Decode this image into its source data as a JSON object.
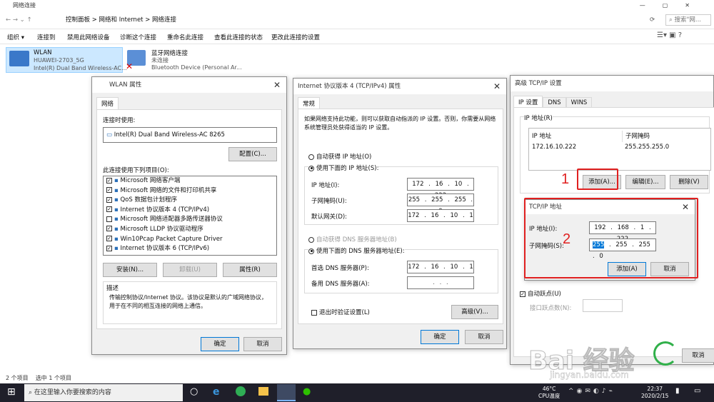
{
  "explorer": {
    "title": "网络连接",
    "path": [
      "控制面板",
      "网络和 Internet",
      "网络连接"
    ],
    "search_placeholder": "搜索\"网...",
    "ribbon": [
      "组织 ▾",
      "连接到",
      "禁用此网络设备",
      "诊断这个连接",
      "重命名此连接",
      "查看此连接的状态",
      "更改此连接的设置"
    ],
    "adapters": [
      {
        "name": "WLAN",
        "line1": "HUAWEI-2703_5G",
        "line2": "Intel(R) Dual Band Wireless-AC..."
      },
      {
        "name": "蓝牙网络连接",
        "line1": "未连接",
        "line2": "Bluetooth Device (Personal Ar..."
      }
    ],
    "status": [
      "2 个项目",
      "选中 1 个项目"
    ]
  },
  "wlan": {
    "title": "WLAN 属性",
    "tab": "网络",
    "connect_using": "连接时使用:",
    "adapter": "Intel(R) Dual Band Wireless-AC 8265",
    "configure": "配置(C)...",
    "items_label": "此连接使用下列项目(O):",
    "items": [
      {
        "t": "Microsoft 网络客户端",
        "c": true
      },
      {
        "t": "Microsoft 网络的文件和打印机共享",
        "c": true
      },
      {
        "t": "QoS 数据包计划程序",
        "c": true
      },
      {
        "t": "Internet 协议版本 4 (TCP/IPv4)",
        "c": true
      },
      {
        "t": "Microsoft 网络适配器多路传送器协议",
        "c": false
      },
      {
        "t": "Microsoft LLDP 协议驱动程序",
        "c": true
      },
      {
        "t": "Win10Pcap Packet Capture Driver",
        "c": true
      },
      {
        "t": "Internet 协议版本 6 (TCP/IPv6)",
        "c": true
      }
    ],
    "install": "安装(N)...",
    "uninstall": "卸载(U)",
    "properties": "属性(R)",
    "desc_title": "描述",
    "desc": "传输控制协议/Internet 协议。该协议是默认的广域网络协议，用于在不同的相互连接的网络上通信。",
    "ok": "确定",
    "cancel": "取消"
  },
  "ipv4": {
    "title": "Internet 协议版本 4 (TCP/IPv4) 属性",
    "tab": "常规",
    "intro": "如果网络支持此功能，则可以获取自动指派的 IP 设置。否则，你需要从网络系统管理员处获得适当的 IP 设置。",
    "auto_ip": "自动获得 IP 地址(O)",
    "use_ip": "使用下面的 IP 地址(S):",
    "ip_label": "IP 地址(I):",
    "ip": "172 . 16 . 10 . 222",
    "mask_label": "子网掩码(U):",
    "mask": "255 . 255 . 255 . 0",
    "gw_label": "默认网关(D):",
    "gw": "172 . 16 . 10 . 1",
    "auto_dns": "自动获得 DNS 服务器地址(B)",
    "use_dns": "使用下面的 DNS 服务器地址(E):",
    "dns1_label": "首选 DNS 服务器(P):",
    "dns1": "172 . 16 . 10 . 1",
    "dns2_label": "备用 DNS 服务器(A):",
    "dns2": ". . .",
    "validate": "退出时验证设置(L)",
    "advanced": "高级(V)...",
    "ok": "确定",
    "cancel": "取消"
  },
  "adv": {
    "title": "高级 TCP/IP 设置",
    "tabs": [
      "IP 设置",
      "DNS",
      "WINS"
    ],
    "group": "IP 地址(R)",
    "col_ip": "IP 地址",
    "col_mask": "子网掩码",
    "row_ip": "172.16.10.222",
    "row_mask": "255.255.255.0",
    "add": "添加(A)...",
    "edit": "编辑(E)...",
    "delete": "删除(V)",
    "auto_metric": "自动跃点(U)",
    "metric_label": "接口跃点数(N):",
    "cancel": "取消"
  },
  "tcpip": {
    "title": "TCP/IP 地址",
    "ip_label": "IP 地址(I):",
    "ip": "192 . 168 . 1 . 222",
    "mask_label": "子网掩码(S):",
    "mask_sel": "255",
    "mask_rest": ". 255 . 255 . 0",
    "add": "添加(A)",
    "cancel": "取消"
  },
  "annot": {
    "n1": "1",
    "n2": "2"
  },
  "taskbar": {
    "search": "在这里输入你要搜索的内容",
    "temp": "46°C",
    "temp_label": "CPU温度",
    "time": "22:37",
    "date": "2020/2/15"
  },
  "watermark": {
    "text": "Bai 经验",
    "url": "jingyan.baidu.com"
  }
}
